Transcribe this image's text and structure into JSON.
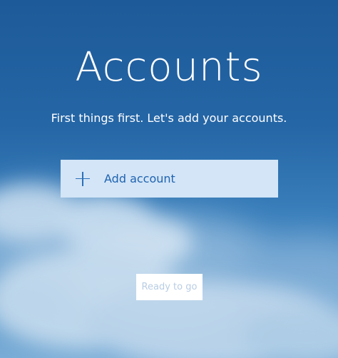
{
  "header": {
    "title": "Accounts",
    "subtitle": "First things first. Let's add your accounts."
  },
  "actions": {
    "add_account_label": "Add account",
    "ready_label": "Ready to go"
  },
  "colors": {
    "add_button_bg": "#d3e5f7",
    "add_button_text": "#1f63b0",
    "ready_button_text": "#b9cde4"
  },
  "icons": {
    "add": "plus-icon"
  }
}
